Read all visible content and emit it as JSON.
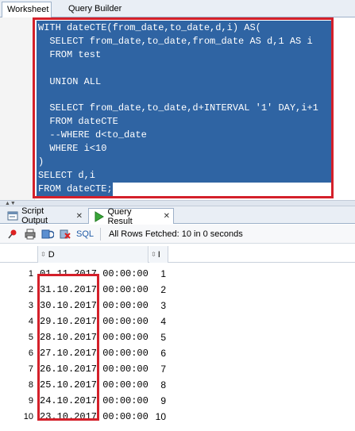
{
  "top_tabs": {
    "worksheet": "Worksheet",
    "query_builder": "Query Builder"
  },
  "editor": {
    "lines": [
      "WITH dateCTE(from_date,to_date,d,i) AS(",
      "  SELECT from_date,to_date,from_date AS d,1 AS i",
      "  FROM test",
      "",
      "  UNION ALL",
      "",
      "  SELECT from_date,to_date,d+INTERVAL '1' DAY,i+1",
      "  FROM dateCTE",
      "  --WHERE d<to_date",
      "  WHERE i<10",
      ")",
      "SELECT d,i",
      "FROM dateCTE;"
    ]
  },
  "output_tabs": {
    "script_output": "Script Output",
    "query_result": "Query Result"
  },
  "toolbar": {
    "sql_label": "SQL",
    "status": "All Rows Fetched: 10 in 0 seconds"
  },
  "grid": {
    "columns": {
      "d": "D",
      "i": "I"
    },
    "rows": [
      {
        "n": "1",
        "d": "01.11.2017  00:00:00",
        "i": "1"
      },
      {
        "n": "2",
        "d": "31.10.2017  00:00:00",
        "i": "2"
      },
      {
        "n": "3",
        "d": "30.10.2017  00:00:00",
        "i": "3"
      },
      {
        "n": "4",
        "d": "29.10.2017  00:00:00",
        "i": "4"
      },
      {
        "n": "5",
        "d": "28.10.2017  00:00:00",
        "i": "5"
      },
      {
        "n": "6",
        "d": "27.10.2017  00:00:00",
        "i": "6"
      },
      {
        "n": "7",
        "d": "26.10.2017  00:00:00",
        "i": "7"
      },
      {
        "n": "8",
        "d": "25.10.2017  00:00:00",
        "i": "8"
      },
      {
        "n": "9",
        "d": "24.10.2017  00:00:00",
        "i": "9"
      },
      {
        "n": "10",
        "d": "23.10.2017  00:00:00",
        "i": "10"
      }
    ]
  },
  "colors": {
    "selection": "#2f64a3",
    "highlight_box": "#d4202a"
  }
}
